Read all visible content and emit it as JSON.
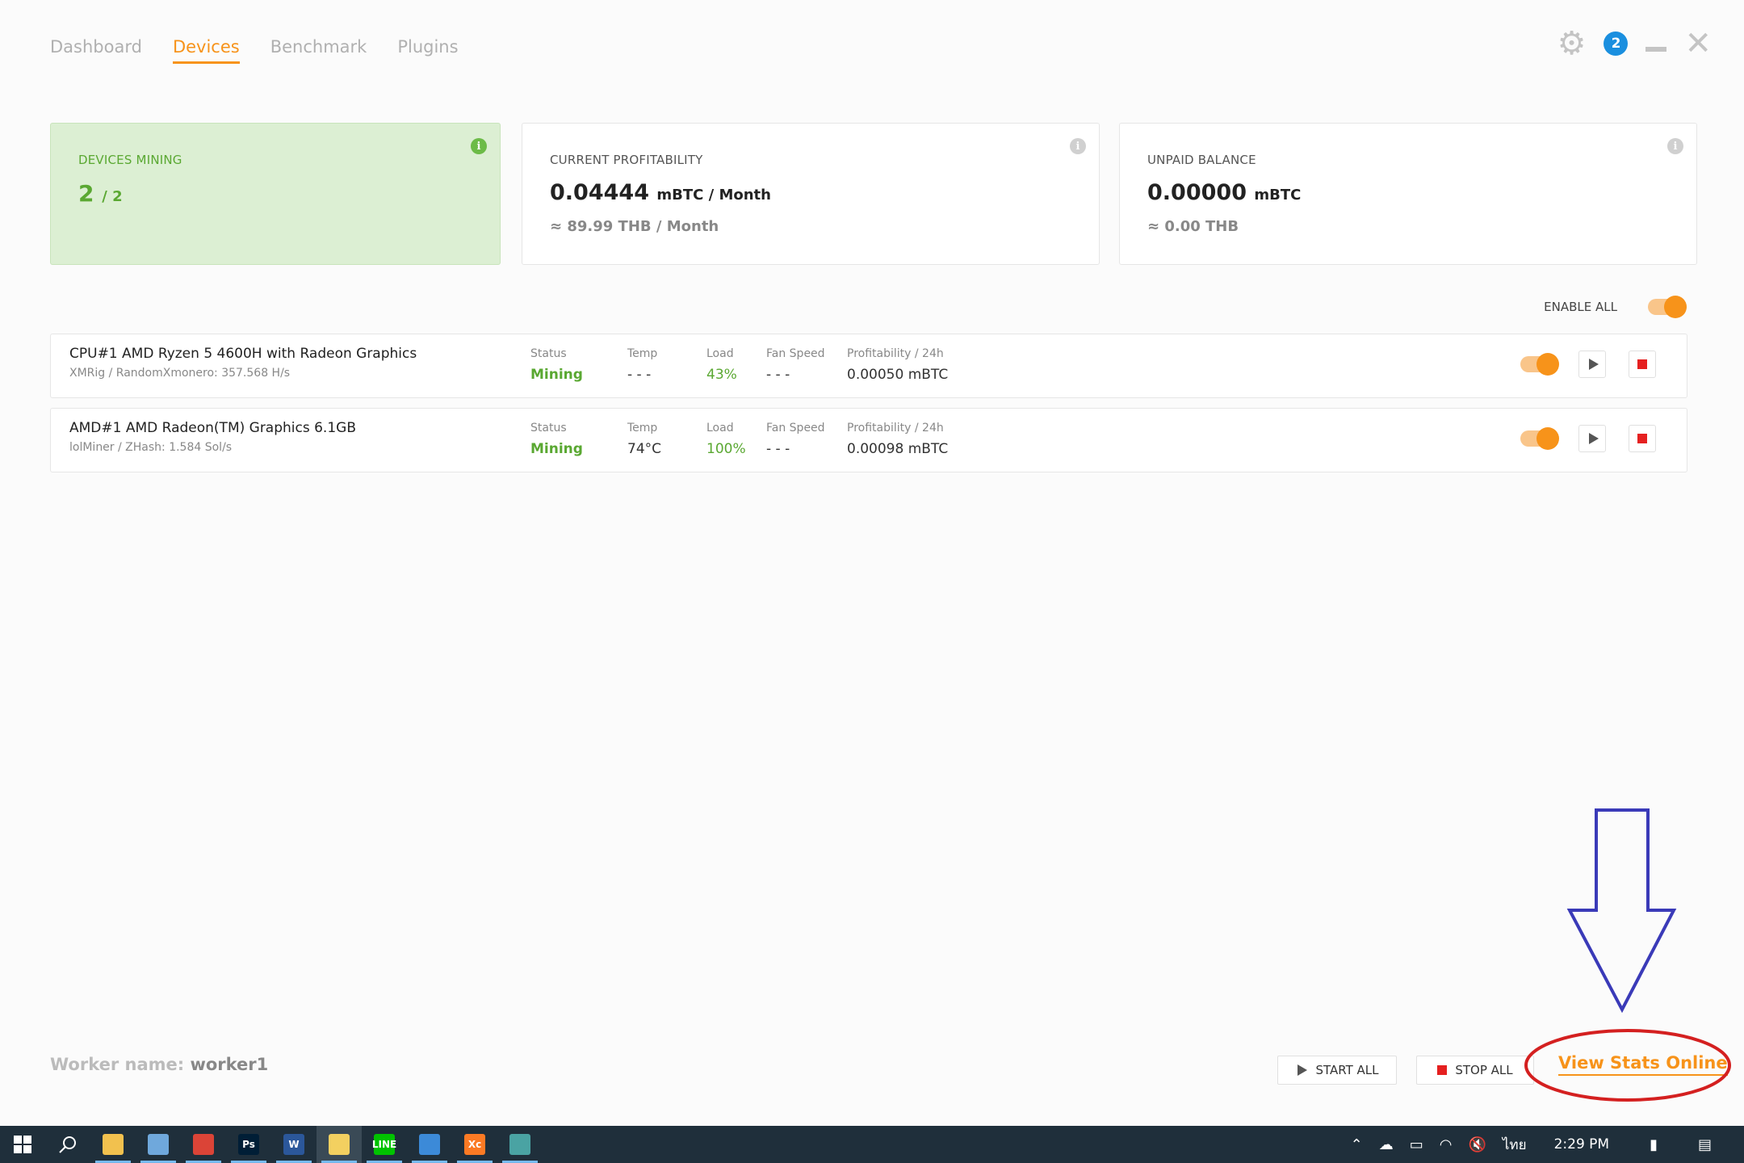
{
  "nav": {
    "tabs": [
      {
        "label": "Dashboard"
      },
      {
        "label": "Devices"
      },
      {
        "label": "Benchmark"
      },
      {
        "label": "Plugins"
      }
    ],
    "notification_count": "2"
  },
  "cards": {
    "devices_mining": {
      "title": "DEVICES MINING",
      "active": "2",
      "total": "/ 2"
    },
    "profitability": {
      "title": "CURRENT PROFITABILITY",
      "value": "0.04444",
      "unit": "mBTC / Month",
      "fiat": "≈ 89.99 THB / Month"
    },
    "balance": {
      "title": "UNPAID BALANCE",
      "value": "0.00000",
      "unit": "mBTC",
      "fiat": "≈ 0.00 THB"
    }
  },
  "enable_all_label": "ENABLE ALL",
  "columns": {
    "status": "Status",
    "temp": "Temp",
    "load": "Load",
    "fan": "Fan Speed",
    "profit": "Profitability / 24h"
  },
  "devices": [
    {
      "name": "CPU#1 AMD Ryzen 5 4600H with Radeon Graphics",
      "algo": "XMRig / RandomXmonero: 357.568 H/s",
      "status": "Mining",
      "temp": "- - -",
      "load": "43%",
      "fan": "- - -",
      "profit": "0.00050 mBTC"
    },
    {
      "name": "AMD#1 AMD Radeon(TM) Graphics 6.1GB",
      "algo": "lolMiner / ZHash: 1.584 Sol/s",
      "status": "Mining",
      "temp": "74°C",
      "load": "100%",
      "fan": "- - -",
      "profit": "0.00098 mBTC"
    }
  ],
  "footer": {
    "worker_label": "Worker name:",
    "worker_value": "worker1",
    "start_all": "START ALL",
    "stop_all": "STOP ALL",
    "view_stats": "View Stats Online"
  },
  "taskbar": {
    "time": "2:29 PM",
    "language": "ไทย",
    "apps": [
      {
        "name": "file-explorer-icon",
        "color": "#f2c14e",
        "label": ""
      },
      {
        "name": "image-viewer-icon",
        "color": "#6fa8dc",
        "label": ""
      },
      {
        "name": "chrome-icon",
        "color": "#db4437",
        "label": ""
      },
      {
        "name": "photoshop-icon",
        "color": "#001e36",
        "label": "Ps"
      },
      {
        "name": "word-icon",
        "color": "#2b579a",
        "label": "W"
      },
      {
        "name": "nicehash-icon",
        "color": "#f3d060",
        "label": ""
      },
      {
        "name": "line-icon",
        "color": "#00c300",
        "label": "LINE"
      },
      {
        "name": "photos-icon",
        "color": "#3c8ad8",
        "label": ""
      },
      {
        "name": "xampp-icon",
        "color": "#fb7a24",
        "label": "Xc"
      },
      {
        "name": "window-app-icon",
        "color": "#4aa3a3",
        "label": ""
      }
    ]
  },
  "colors": {
    "accent": "#f7931a",
    "green": "#5aa832",
    "stop": "#e52020",
    "annotation_arrow": "#3a3ab8",
    "annotation_circle": "#d42020"
  }
}
